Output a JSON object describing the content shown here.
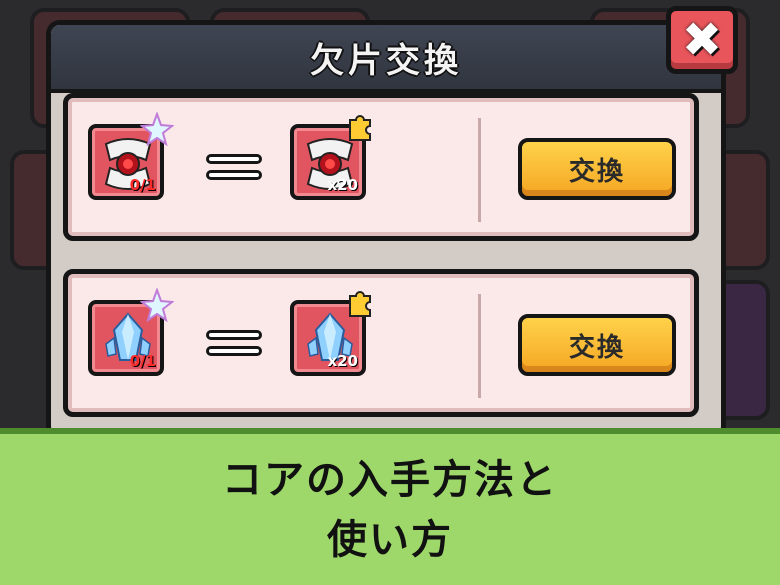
{
  "modal": {
    "title": "欠片交換",
    "close_label": "✖"
  },
  "rows": [
    {
      "item_a": {
        "icon": "fang-core-icon",
        "qty": "0/1",
        "badge": "star-icon"
      },
      "item_b": {
        "icon": "fang-shard-icon",
        "qty": "x20",
        "badge": "puzzle-icon"
      },
      "button_label": "交換"
    },
    {
      "item_a": {
        "icon": "crystal-core-icon",
        "qty": "0/1",
        "badge": "star-icon"
      },
      "item_b": {
        "icon": "crystal-shard-icon",
        "qty": "x20",
        "badge": "puzzle-icon"
      },
      "button_label": "交換"
    }
  ],
  "banner": {
    "line1": "コアの入手方法と",
    "line2": "使い方"
  },
  "colors": {
    "header": "#3a3f4a",
    "row_bg": "#fbe9ea",
    "item_bg": "#e15560",
    "button": "#f7b733",
    "close": "#e8555b",
    "banner": "#9ed86a"
  }
}
